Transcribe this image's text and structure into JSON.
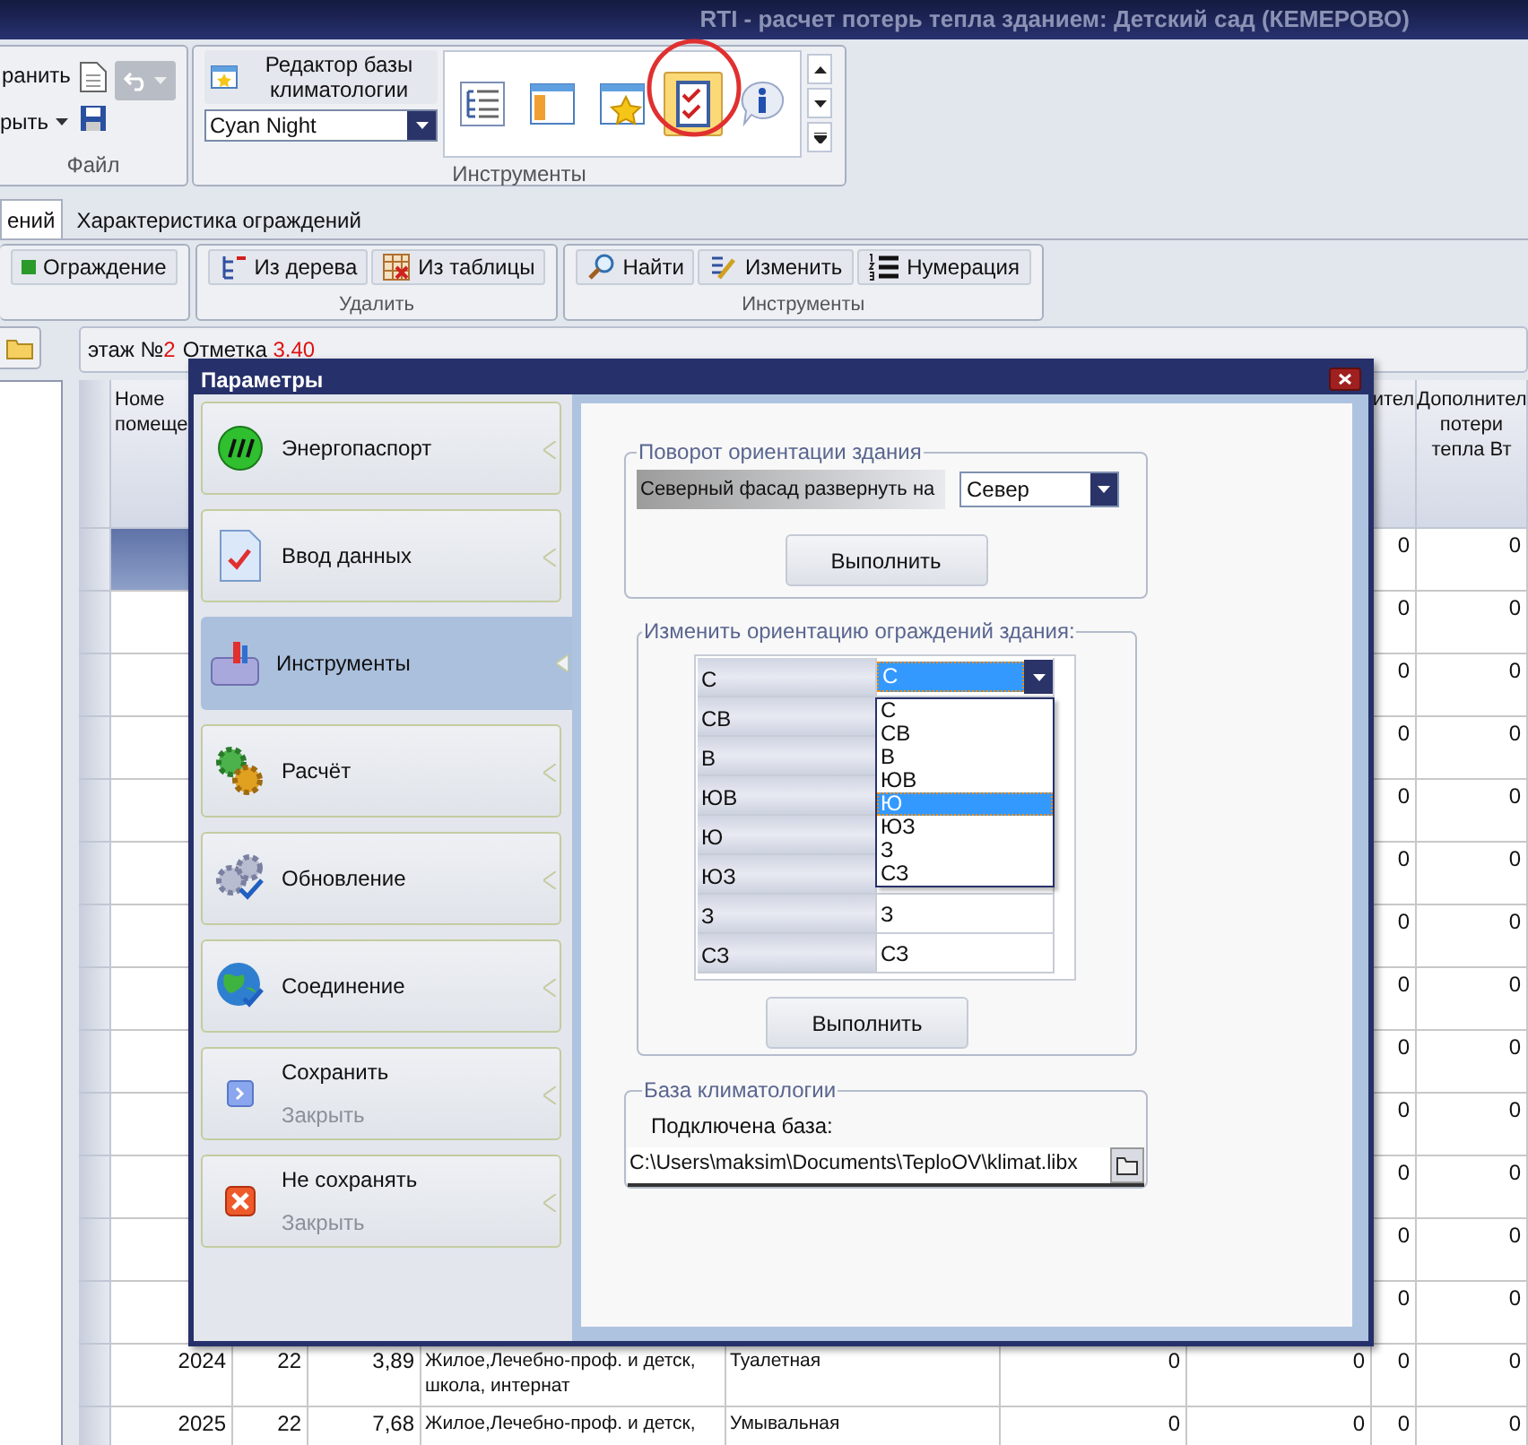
{
  "window": {
    "title": "RTI - расчет потерь тепла зданием: Детский сад (КЕМЕРОВО)"
  },
  "ribbon": {
    "file": {
      "label": "Файл",
      "save": "ранить",
      "open": "рыть"
    },
    "tools": {
      "label": "Инструменты",
      "editor_button": "Редактор базы климатологии",
      "theme": "Cyan Night",
      "gallery": [
        {
          "kind": "tree",
          "selected": false
        },
        {
          "kind": "panels",
          "selected": false
        },
        {
          "kind": "favorite",
          "selected": false
        },
        {
          "kind": "checklist",
          "selected": true
        },
        {
          "kind": "info",
          "selected": false
        }
      ]
    }
  },
  "tabs": [
    {
      "label": "ений",
      "selected": true
    },
    {
      "label": "Характеристика ограждений",
      "selected": false
    }
  ],
  "toolbar": [
    {
      "buttons": [
        {
          "label": "Ограждение",
          "kind": "add"
        }
      ]
    },
    {
      "label": "Удалить",
      "buttons": [
        {
          "label": "Из дерева",
          "kind": "tree"
        },
        {
          "label": "Из таблицы",
          "kind": "table"
        }
      ]
    },
    {
      "label": "Инструменты",
      "buttons": [
        {
          "label": "Найти",
          "kind": "find"
        },
        {
          "label": "Изменить",
          "kind": "edit"
        },
        {
          "label": "Нумерация",
          "kind": "numbering"
        }
      ]
    }
  ],
  "breadcrumb": {
    "floor_label": "этаж №",
    "floor": "2",
    "mark_label": "Отметка",
    "mark": "3.40"
  },
  "table": {
    "header": {
      "number": "Номе\nпомеще",
      "column_8": "ител",
      "column_9": "Дополнител\nпотери\nтепла Вт"
    },
    "rows": [
      {
        "selected": true,
        "column_8": "0",
        "column_9": "0"
      },
      {
        "selected": false,
        "column_8": "0",
        "column_9": "0"
      },
      {
        "selected": false,
        "column_8": "0",
        "column_9": "0"
      },
      {
        "selected": false,
        "column_8": "0",
        "column_9": "0"
      },
      {
        "selected": false,
        "column_8": "0",
        "column_9": "0"
      },
      {
        "selected": false,
        "column_8": "0",
        "column_9": "0"
      },
      {
        "selected": false,
        "column_8": "0",
        "column_9": "0"
      },
      {
        "selected": false,
        "column_8": "0",
        "column_9": "0"
      },
      {
        "selected": false,
        "column_8": "0",
        "column_9": "0"
      },
      {
        "selected": false,
        "column_8": "0",
        "column_9": "0"
      },
      {
        "selected": false,
        "column_8": "0",
        "column_9": "0"
      },
      {
        "selected": false,
        "column_8": "0",
        "column_9": "0"
      },
      {
        "selected": false,
        "column_8": "0",
        "column_9": "0"
      },
      {
        "selected": false,
        "number": "2024",
        "column_2": "22",
        "column_3": "3,89",
        "column_4": "Жилое,Лечебно-проф. и детск, школа, интернат",
        "column_5": "Туалетная",
        "column_6": "0",
        "column_7": "0",
        "column_8": "0",
        "column_9": "0"
      },
      {
        "selected": false,
        "number": "2025",
        "column_2": "22",
        "column_3": "7,68",
        "column_4": "Жилое,Лечебно-проф. и детск,",
        "column_5": "Умывальная",
        "column_6": "0",
        "column_7": "0",
        "column_8": "0",
        "column_9": "0"
      }
    ]
  },
  "dialog": {
    "title": "Параметры",
    "nav": [
      {
        "label": "Энергопаспорт",
        "kind": "passport",
        "selected": false
      },
      {
        "label": "Ввод данных",
        "kind": "input",
        "selected": false
      },
      {
        "label": "Инструменты",
        "kind": "tools",
        "selected": true
      },
      {
        "label": "Расчёт",
        "kind": "calc",
        "selected": false
      },
      {
        "label": "Обновление",
        "kind": "update",
        "selected": false
      },
      {
        "label": "Соединение",
        "kind": "connect",
        "selected": false
      },
      {
        "label": "Сохранить",
        "sublabel": "Закрыть",
        "kind": "save",
        "selected": false
      },
      {
        "label": "Не сохранять",
        "sublabel": "Закрыть",
        "kind": "discard",
        "selected": false
      }
    ],
    "rotation": {
      "legend": "Поворот ориентации здания",
      "label": "Северный фасад развернуть на",
      "value": "Север",
      "button": "Выполнить"
    },
    "orientation": {
      "legend": "Изменить ориентацию ограждений здания:",
      "rows": [
        {
          "label": "С",
          "value": "С",
          "open": true
        },
        {
          "label": "СВ",
          "open": false
        },
        {
          "label": "В",
          "open": false
        },
        {
          "label": "ЮВ",
          "open": false
        },
        {
          "label": "Ю",
          "open": false
        },
        {
          "label": "ЮЗ",
          "open": false
        },
        {
          "label": "З",
          "value": "З",
          "open": false
        },
        {
          "label": "СЗ",
          "value": "СЗ",
          "open": false
        }
      ],
      "options": [
        {
          "label": "С",
          "selected": false
        },
        {
          "label": "СВ",
          "selected": false
        },
        {
          "label": "В",
          "selected": false
        },
        {
          "label": "ЮВ",
          "selected": false
        },
        {
          "label": "Ю",
          "selected": true
        },
        {
          "label": "ЮЗ",
          "selected": false
        },
        {
          "label": "З",
          "selected": false
        },
        {
          "label": "СЗ",
          "selected": false
        }
      ],
      "button": "Выполнить"
    },
    "climate": {
      "legend": "База климатологии",
      "label": "Подключена база:",
      "path": "C:\\Users\\maksim\\Documents\\TeploOV\\klimat.libx"
    }
  }
}
